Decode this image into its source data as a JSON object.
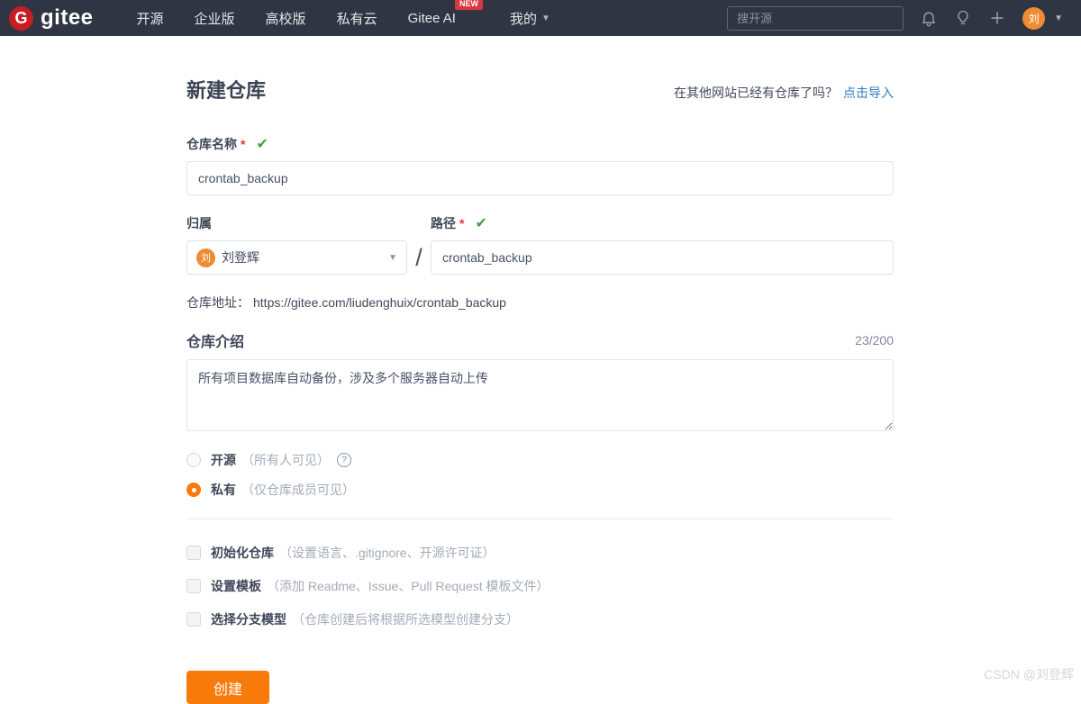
{
  "navbar": {
    "logo_letter": "G",
    "logo_text": "gitee",
    "menu": [
      {
        "label": "开源"
      },
      {
        "label": "企业版"
      },
      {
        "label": "高校版"
      },
      {
        "label": "私有云"
      },
      {
        "label": "Gitee AI",
        "badge": "NEW"
      },
      {
        "label": "我的"
      }
    ],
    "search_placeholder": "搜开源",
    "avatar_letter": "刘"
  },
  "header": {
    "title": "新建仓库",
    "import_hint": "在其他网站已经有仓库了吗？",
    "import_link": "点击导入"
  },
  "form": {
    "name": {
      "label": "仓库名称",
      "required": "*",
      "value": "crontab_backup"
    },
    "owner": {
      "label": "归属",
      "selected": "刘登辉",
      "avatar_letter": "刘"
    },
    "path_separator": "/",
    "path": {
      "label": "路径",
      "required": "*",
      "value": "crontab_backup"
    },
    "repo_url": {
      "label": "仓库地址：",
      "value": "https://gitee.com/liudenghuix/crontab_backup"
    },
    "description": {
      "label": "仓库介绍",
      "counter": "23/200",
      "value": "所有项目数据库自动备份，涉及多个服务器自动上传"
    },
    "visibility": [
      {
        "label": "开源",
        "hint": "（所有人可见）",
        "selected": false
      },
      {
        "label": "私有",
        "hint": "（仅仓库成员可见）",
        "selected": true
      }
    ],
    "options": [
      {
        "label": "初始化仓库",
        "hint": "（设置语言、.gitignore、开源许可证）",
        "checked": false
      },
      {
        "label": "设置模板",
        "hint": "（添加 Readme、Issue、Pull Request 模板文件）",
        "checked": false
      },
      {
        "label": "选择分支模型",
        "hint": "（仓库创建后将根据所选模型创建分支）",
        "checked": false
      }
    ],
    "submit_label": "创建"
  },
  "watermark": "CSDN @刘登辉",
  "colors": {
    "navbar_bg": "#2f3542",
    "brand_red": "#c71d23",
    "badge_red": "#d9363e",
    "accent_orange": "#f87a0b",
    "avatar_orange": "#ef8b32",
    "link_blue": "#2d7bbd",
    "check_green": "#43a047"
  }
}
